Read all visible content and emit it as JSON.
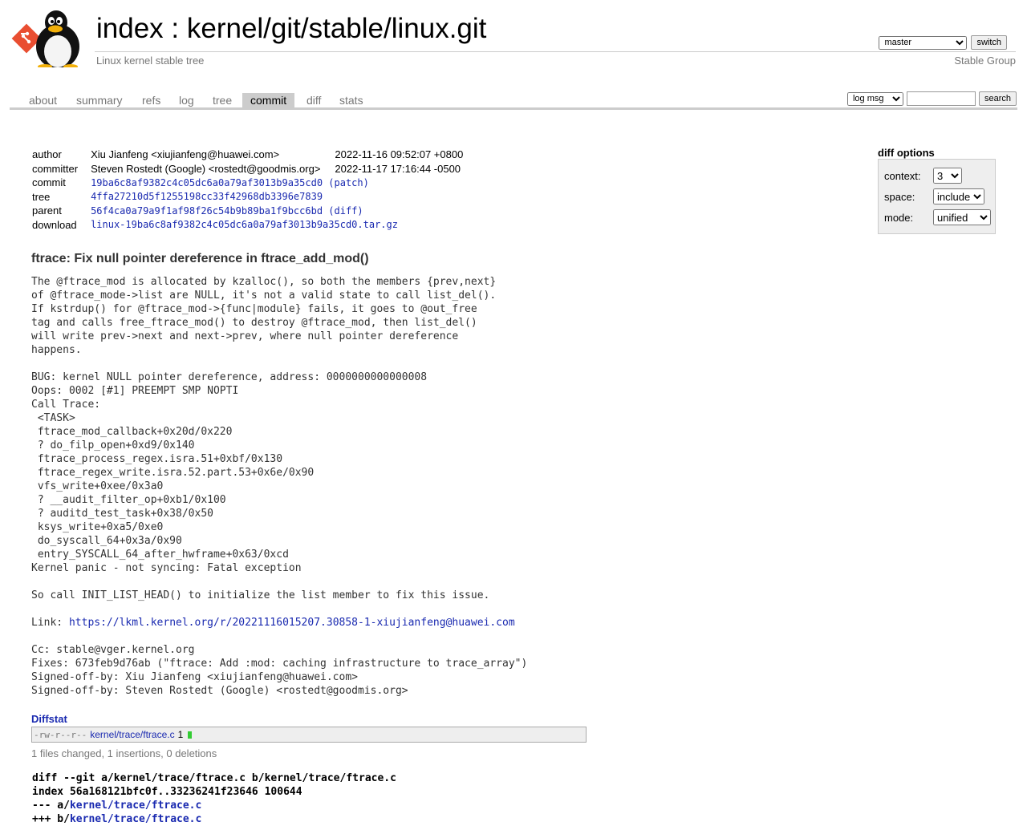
{
  "header": {
    "title_index": "index",
    "title_sep": " : ",
    "title_repo": "kernel/git/stable/linux.git",
    "description": "Linux kernel stable tree",
    "owner": "Stable Group",
    "branch_selected": "master",
    "switch_label": "switch"
  },
  "tabs": [
    "about",
    "summary",
    "refs",
    "log",
    "tree",
    "commit",
    "diff",
    "stats"
  ],
  "search": {
    "type_selected": "log msg",
    "value": "",
    "button_label": "search"
  },
  "commit": {
    "author_label": "author",
    "author": "Xiu Jianfeng <xiujianfeng@huawei.com>",
    "author_date": "2022-11-16 09:52:07 +0800",
    "committer_label": "committer",
    "committer": "Steven Rostedt (Google) <rostedt@goodmis.org>",
    "committer_date": "2022-11-17 17:16:44 -0500",
    "commit_label": "commit",
    "commit_hash": "19ba6c8af9382c4c05dc6a0a79af3013b9a35cd0",
    "patch_label": "(patch)",
    "tree_label": "tree",
    "tree_hash": "4ffa27210d5f1255198cc33f42968db3396e7839",
    "parent_label": "parent",
    "parent_hash": "56f4ca0a79a9f1af98f26c54b9b89ba1f9bcc6bd",
    "diff_label": "(diff)",
    "download_label": "download",
    "download_file": "linux-19ba6c8af9382c4c05dc6a0a79af3013b9a35cd0.tar.gz"
  },
  "diff_options": {
    "title": "diff options",
    "context_label": "context:",
    "context_value": "3",
    "space_label": "space:",
    "space_value": "include",
    "mode_label": "mode:",
    "mode_value": "unified"
  },
  "message": {
    "subject": "ftrace: Fix null pointer dereference in ftrace_add_mod()",
    "body_before_link": "The @ftrace_mod is allocated by kzalloc(), so both the members {prev,next}\nof @ftrace_mode->list are NULL, it's not a valid state to call list_del().\nIf kstrdup() for @ftrace_mod->{func|module} fails, it goes to @out_free\ntag and calls free_ftrace_mod() to destroy @ftrace_mod, then list_del()\nwill write prev->next and next->prev, where null pointer dereference\nhappens.\n\nBUG: kernel NULL pointer dereference, address: 0000000000000008\nOops: 0002 [#1] PREEMPT SMP NOPTI\nCall Trace:\n <TASK>\n ftrace_mod_callback+0x20d/0x220\n ? do_filp_open+0xd9/0x140\n ftrace_process_regex.isra.51+0xbf/0x130\n ftrace_regex_write.isra.52.part.53+0x6e/0x90\n vfs_write+0xee/0x3a0\n ? __audit_filter_op+0xb1/0x100\n ? auditd_test_task+0x38/0x50\n ksys_write+0xa5/0xe0\n do_syscall_64+0x3a/0x90\n entry_SYSCALL_64_after_hwframe+0x63/0xcd\nKernel panic - not syncing: Fatal exception\n\nSo call INIT_LIST_HEAD() to initialize the list member to fix this issue.\n\nLink: ",
    "link": "https://lkml.kernel.org/r/20221116015207.30858-1-xiujianfeng@huawei.com",
    "body_after_link": "\n\nCc: stable@vger.kernel.org\nFixes: 673feb9d76ab (\"ftrace: Add :mod: caching infrastructure to trace_array\")\nSigned-off-by: Xiu Jianfeng <xiujianfeng@huawei.com>\nSigned-off-by: Steven Rostedt (Google) <rostedt@goodmis.org>"
  },
  "diffstat": {
    "header": "Diffstat",
    "mode": "-rw-r--r--",
    "file": "kernel/trace/ftrace.c",
    "count": "1",
    "summary": "1 files changed, 1 insertions, 0 deletions"
  },
  "diff": {
    "line1": "diff --git a/kernel/trace/ftrace.c b/kernel/trace/ftrace.c",
    "line2": "index 56a168121bfc0f..33236241f23646 100644",
    "line3_prefix": "--- a/",
    "line3_file": "kernel/trace/ftrace.c",
    "line4_prefix": "+++ b/",
    "line4_file": "kernel/trace/ftrace.c"
  },
  "colors": {
    "link": "#1a2ab0",
    "tab_active_bg": "#cccccc",
    "diffstat_bar": "#33cc33",
    "muted_text": "#777777"
  }
}
